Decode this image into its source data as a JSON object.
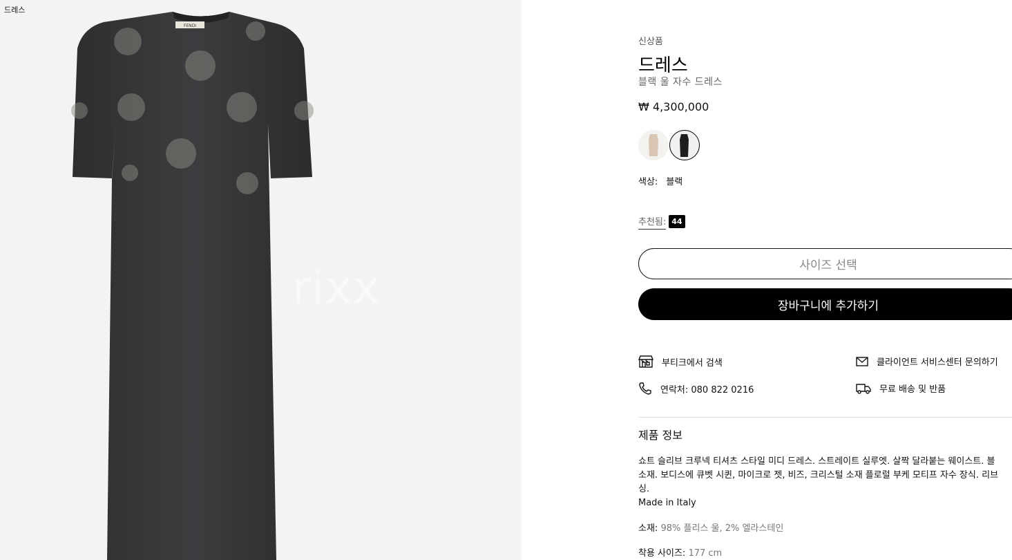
{
  "breadcrumb": "드레스",
  "watermark": "rixx",
  "product": {
    "tag": "신상품",
    "title": "드레스",
    "subtitle": "블랙 울 자수 드레스",
    "price": "₩ 4,300,000",
    "color_label": "색상:",
    "color_value": "블랙",
    "recommended_label": "추천됨:",
    "recommended_size": "44",
    "size_select": "사이즈 선택",
    "add_to_cart": "장바구니에 추가하기"
  },
  "services": {
    "boutique": "부티크에서 검색",
    "client_service": "클라이언트 서비스센터 문의하기",
    "phone": "연락처: 080 822 0216",
    "shipping": "무료 배송 및 반품"
  },
  "info": {
    "heading": "제품 정보",
    "lines": [
      "쇼트 슬리브 크루넥 티셔츠 스타일 미디 드레스. 스트레이트 실루엣. 살짝 달라붙는 웨이스트. 블",
      "소재. 보디스에 큐벳 시퀸, 마이크로 젯, 비즈, 크리스털 소재 플로럴 부케 모티프 자수 장식. 리브",
      "싱.",
      "Made in Italy"
    ],
    "material_label": "소재:",
    "material_value": "98% 플리스 울, 2% 엘라스테인",
    "fit_label": "착용 사이즈:",
    "fit_value": "177 cm"
  },
  "colors": {
    "dress": "#3a3a3c",
    "background": "#f3f3f3",
    "accent": "#000000"
  },
  "icons": [
    "store-icon",
    "mail-icon",
    "phone-icon",
    "delivery-truck-icon"
  ]
}
